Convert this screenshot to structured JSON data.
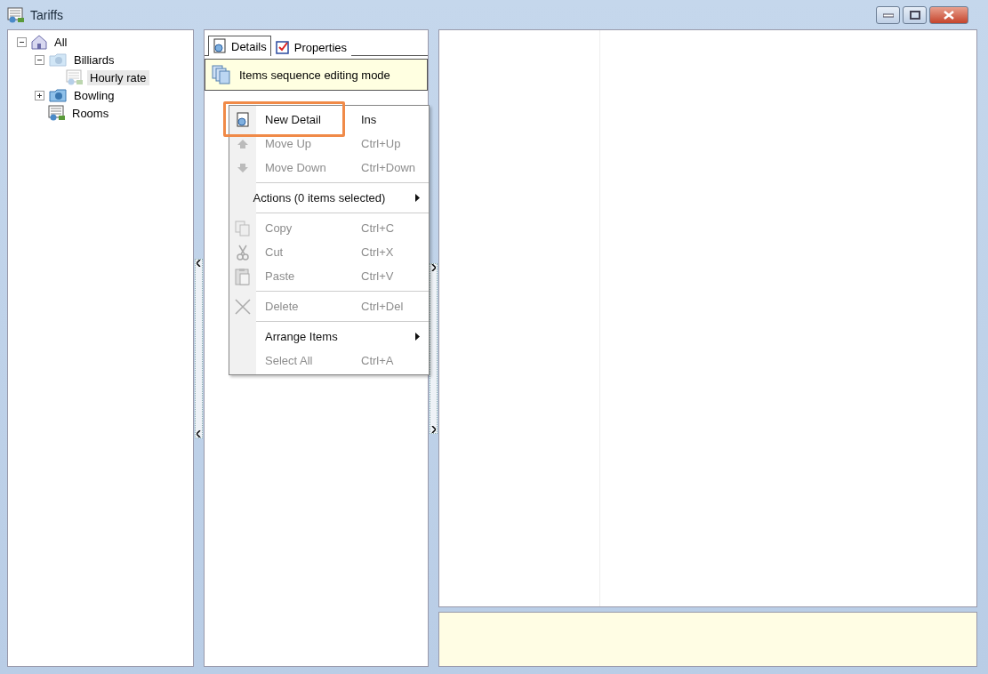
{
  "window": {
    "title": "Tariffs"
  },
  "tree": [
    {
      "label": "All",
      "expanded": true,
      "selected": false,
      "children": [
        {
          "label": "Billiards",
          "expanded": true,
          "selected": false,
          "children": [
            {
              "label": "Hourly rate",
              "selected": true
            }
          ]
        },
        {
          "label": "Bowling",
          "expanded": false,
          "selected": false
        },
        {
          "label": "Rooms",
          "selected": false
        }
      ]
    }
  ],
  "tabs": [
    {
      "label": "Details",
      "selected": true
    },
    {
      "label": "Properties",
      "selected": false
    }
  ],
  "banner": {
    "text": "Items sequence editing mode"
  },
  "context_menu": [
    {
      "kind": "item",
      "label": "New Detail",
      "shortcut": "Ins",
      "disabled": false,
      "highlighted": true
    },
    {
      "kind": "item",
      "label": "Move Up",
      "shortcut": "Ctrl+Up",
      "disabled": true,
      "highlighted": false
    },
    {
      "kind": "item",
      "label": "Move Down",
      "shortcut": "Ctrl+Down",
      "disabled": true,
      "highlighted": false
    },
    {
      "kind": "separator"
    },
    {
      "kind": "submenu",
      "label": "Actions (0 items selected)",
      "disabled": false,
      "highlighted": false
    },
    {
      "kind": "separator"
    },
    {
      "kind": "item",
      "label": "Copy",
      "shortcut": "Ctrl+C",
      "disabled": true,
      "highlighted": false
    },
    {
      "kind": "item",
      "label": "Cut",
      "shortcut": "Ctrl+X",
      "disabled": true,
      "highlighted": false
    },
    {
      "kind": "item",
      "label": "Paste",
      "shortcut": "Ctrl+V",
      "disabled": true,
      "highlighted": false
    },
    {
      "kind": "separator"
    },
    {
      "kind": "item",
      "label": "Delete",
      "shortcut": "Ctrl+Del",
      "disabled": true,
      "highlighted": false
    },
    {
      "kind": "separator"
    },
    {
      "kind": "submenu",
      "label": "Arrange Items",
      "disabled": false,
      "highlighted": false
    },
    {
      "kind": "item",
      "label": "Select All",
      "shortcut": "Ctrl+A",
      "disabled": true,
      "highlighted": false
    }
  ]
}
